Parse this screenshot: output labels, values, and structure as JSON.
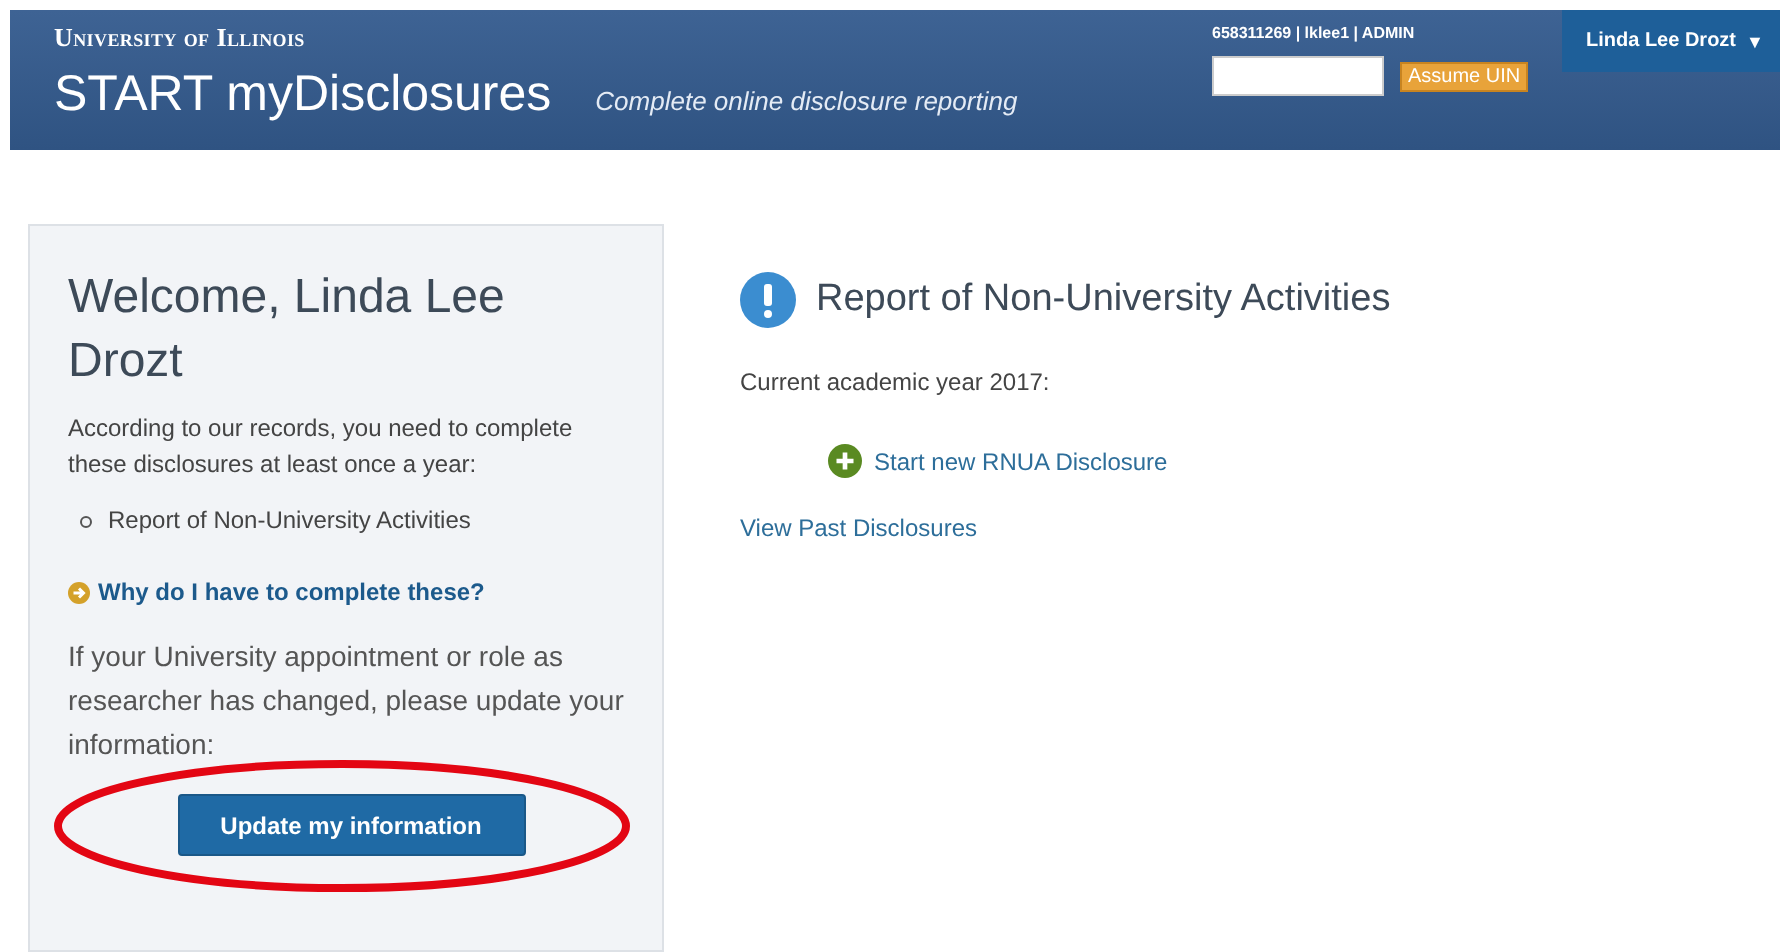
{
  "header": {
    "university": "University of Illinois",
    "app_title": "START myDisclosures",
    "tagline": "Complete online disclosure reporting",
    "user_info": "658311269 | lklee1 | ADMIN",
    "assume_button": "Assume UIN",
    "user_menu": {
      "label": "Linda Lee Drozt",
      "caret": "▼"
    }
  },
  "welcome": {
    "heading": "Welcome, Linda Lee Drozt",
    "intro": "According to our records, you need to complete these disclosures at least once a year:",
    "disclosures": [
      "Report of Non-University Activities"
    ],
    "why_link": "Why do I have to complete these?",
    "update_text": "If your University appointment or role as researcher has changed, please update your information:",
    "update_button": "Update my information"
  },
  "report": {
    "title": "Report of Non-University Activities",
    "year_text": "Current academic year 2017:",
    "start_link": "Start new RNUA Disclosure",
    "past_link": "View Past Disclosures"
  },
  "annotation": {
    "kind": "ellipse"
  }
}
